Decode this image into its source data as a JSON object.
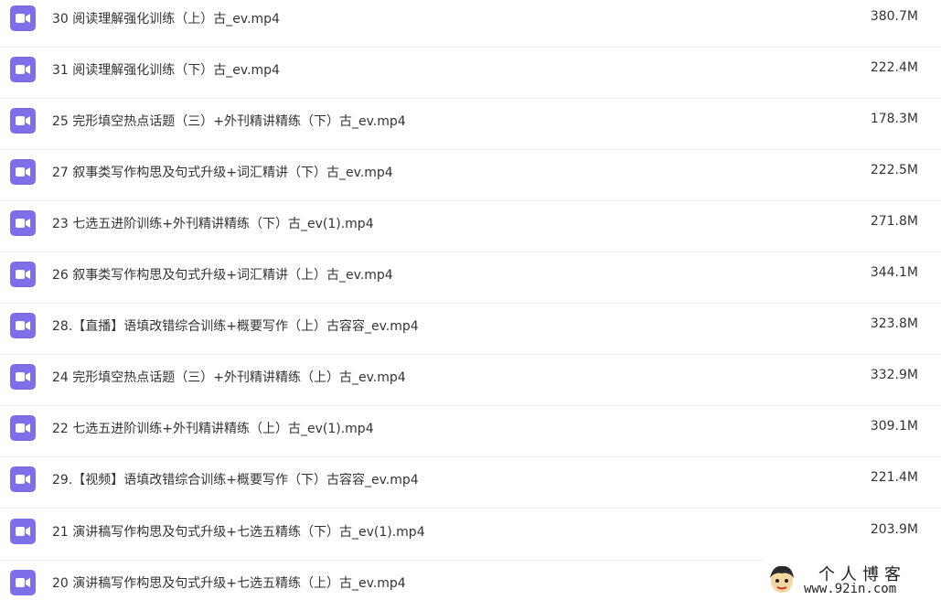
{
  "colors": {
    "icon_bg": "#7d6fea",
    "text": "#333333",
    "divider": "#eeeeee"
  },
  "file_icon": "video-file-icon",
  "files": [
    {
      "name": "30 阅读理解强化训练（上）古_ev.mp4",
      "size": "380.7M"
    },
    {
      "name": "31 阅读理解强化训练（下）古_ev.mp4",
      "size": "222.4M"
    },
    {
      "name": "25 完形填空热点话题（三）+外刊精讲精练（下）古_ev.mp4",
      "size": "178.3M"
    },
    {
      "name": "27 叙事类写作构思及句式升级+词汇精讲（下）古_ev.mp4",
      "size": "222.5M"
    },
    {
      "name": "23 七选五进阶训练+外刊精讲精练（下）古_ev(1).mp4",
      "size": "271.8M"
    },
    {
      "name": "26 叙事类写作构思及句式升级+词汇精讲（上）古_ev.mp4",
      "size": "344.1M"
    },
    {
      "name": "28.【直播】语填改错综合训练+概要写作（上）古容容_ev.mp4",
      "size": "323.8M"
    },
    {
      "name": "24 完形填空热点话题（三）+外刊精讲精练（上）古_ev.mp4",
      "size": "332.9M"
    },
    {
      "name": "22 七选五进阶训练+外刊精讲精练（上）古_ev(1).mp4",
      "size": "309.1M"
    },
    {
      "name": "29.【视频】语填改错综合训练+概要写作（下）古容容_ev.mp4",
      "size": "221.4M"
    },
    {
      "name": "21 演讲稿写作构思及句式升级+七选五精练（下）古_ev(1).mp4",
      "size": "203.9M"
    },
    {
      "name": "20 演讲稿写作构思及句式升级+七选五精练（上）古_ev.mp4",
      "size": ""
    }
  ],
  "watermark": {
    "title": "个人博客",
    "url": "www.92in.com"
  }
}
